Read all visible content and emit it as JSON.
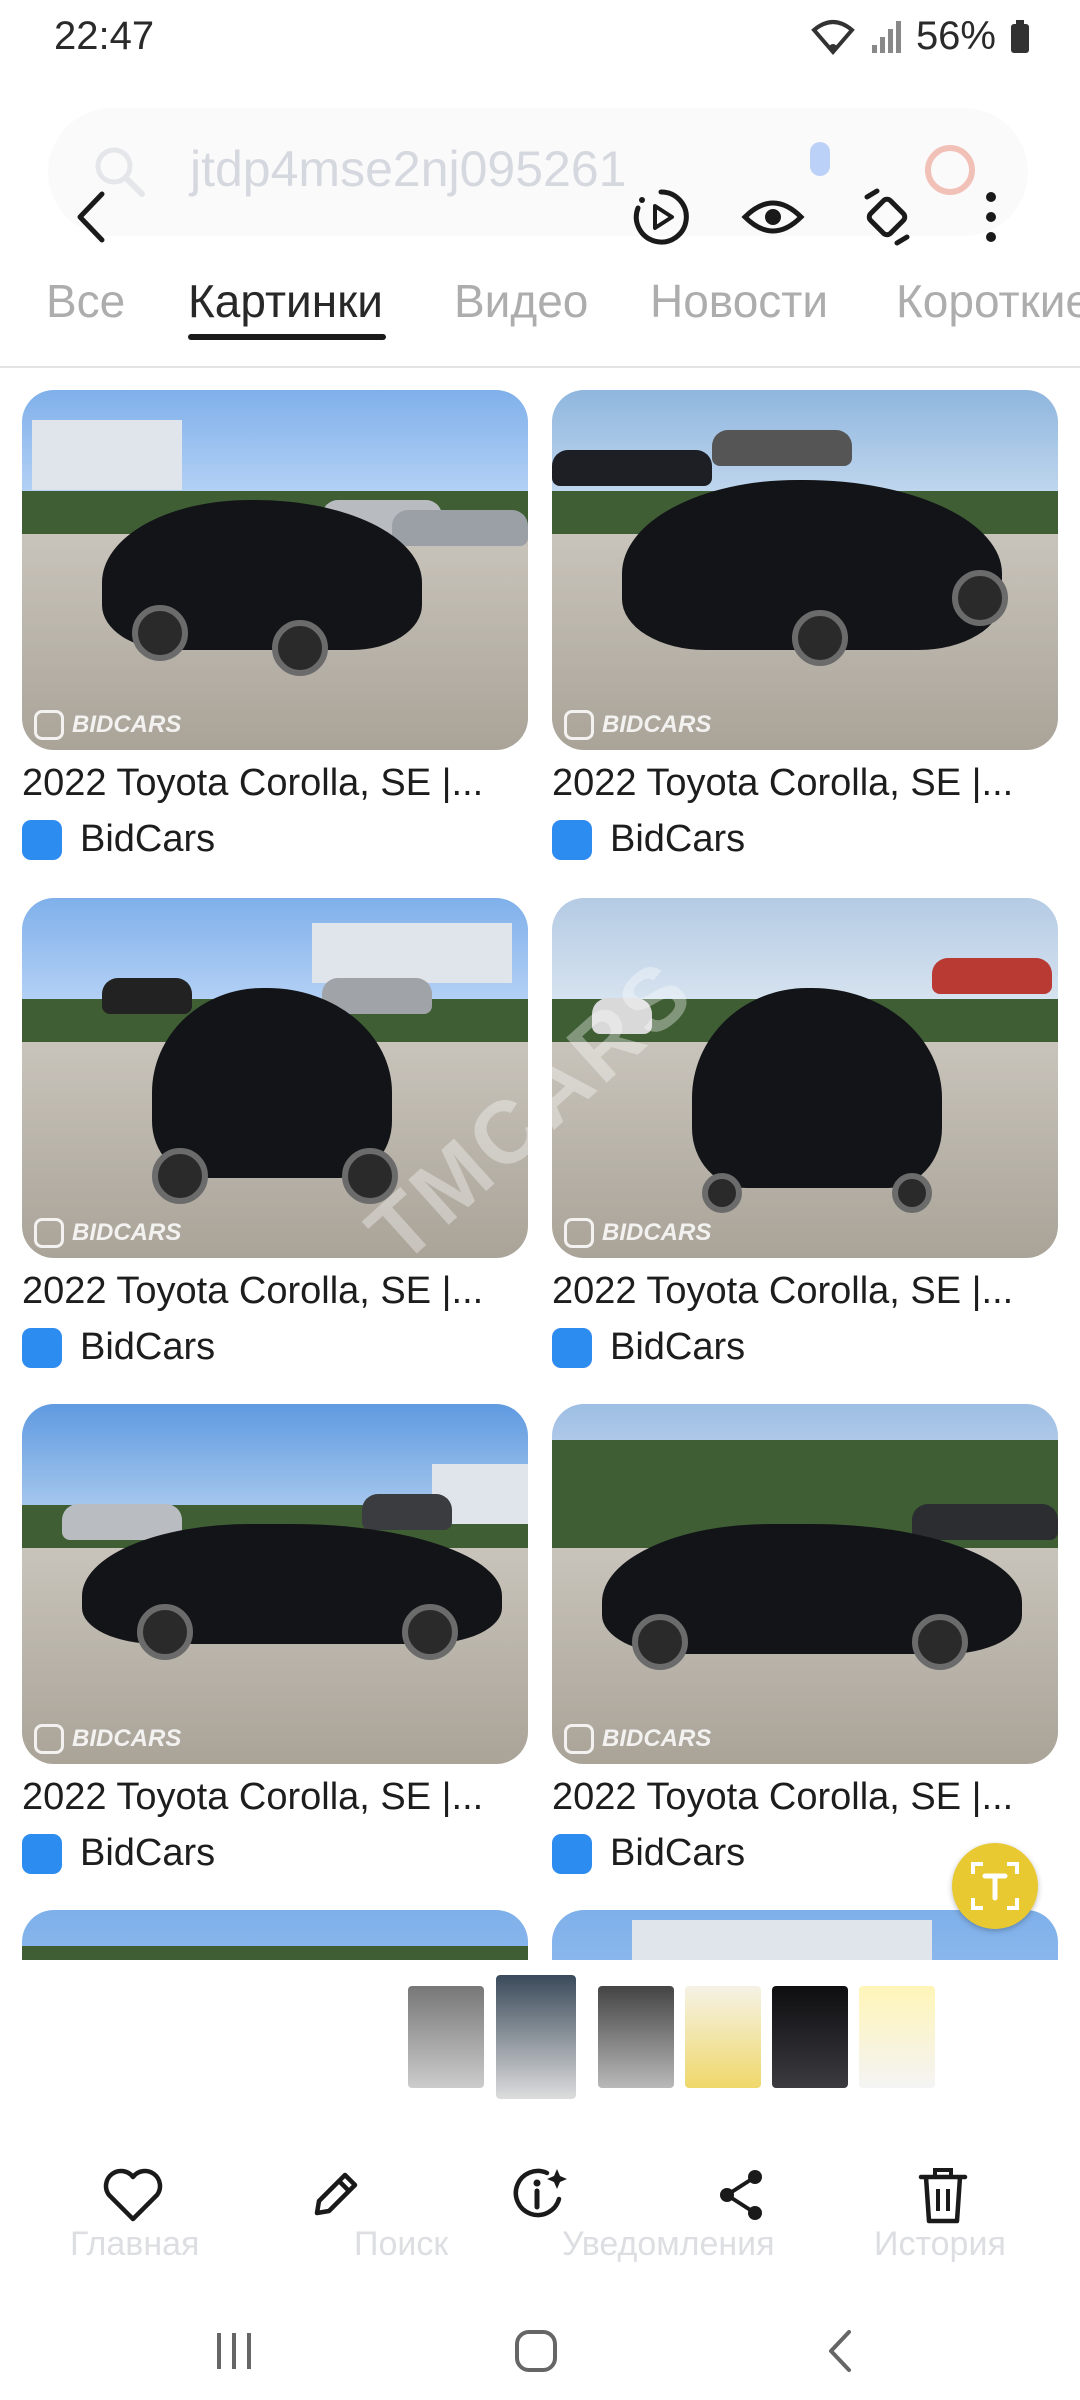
{
  "status_bar": {
    "time": "22:47",
    "battery_text": "56%"
  },
  "search": {
    "query": "jtdp4mse2nj095261"
  },
  "tabs": [
    {
      "label": "Все",
      "active": false
    },
    {
      "label": "Картинки",
      "active": true
    },
    {
      "label": "Видео",
      "active": false
    },
    {
      "label": "Новости",
      "active": false
    },
    {
      "label": "Короткие",
      "active": false
    }
  ],
  "results": [
    {
      "title": "2022 Toyota Corolla, SE |...",
      "source": "BidCars",
      "watermark": "BIDCARS"
    },
    {
      "title": "2022 Toyota Corolla, SE |...",
      "source": "BidCars",
      "watermark": "BIDCARS"
    },
    {
      "title": "2022 Toyota Corolla, SE |...",
      "source": "BidCars",
      "watermark": "BIDCARS"
    },
    {
      "title": "2022 Toyota Corolla, SE |...",
      "source": "BidCars",
      "watermark": "BIDCARS"
    },
    {
      "title": "2022 Toyota Corolla, SE |...",
      "source": "BidCars",
      "watermark": "BIDCARS"
    },
    {
      "title": "2022 Toyota Corolla, SE |...",
      "source": "BidCars",
      "watermark": "BIDCARS"
    }
  ],
  "overlay_watermark": "TMCARS",
  "ghost_nav": [
    "Главная",
    "Поиск",
    "Уведомления",
    "История"
  ],
  "colors": {
    "accent_blue": "#2d8cf0",
    "fab_yellow": "#e8c932"
  },
  "icons": {
    "toolbar": [
      "back-icon",
      "motion-photo-icon",
      "eye-icon",
      "rotate-icon",
      "more-icon"
    ],
    "actions": [
      "heart-icon",
      "edit-icon",
      "info-ai-icon",
      "share-icon",
      "trash-icon"
    ],
    "system": [
      "recents-icon",
      "home-icon",
      "back-nav-icon"
    ]
  }
}
